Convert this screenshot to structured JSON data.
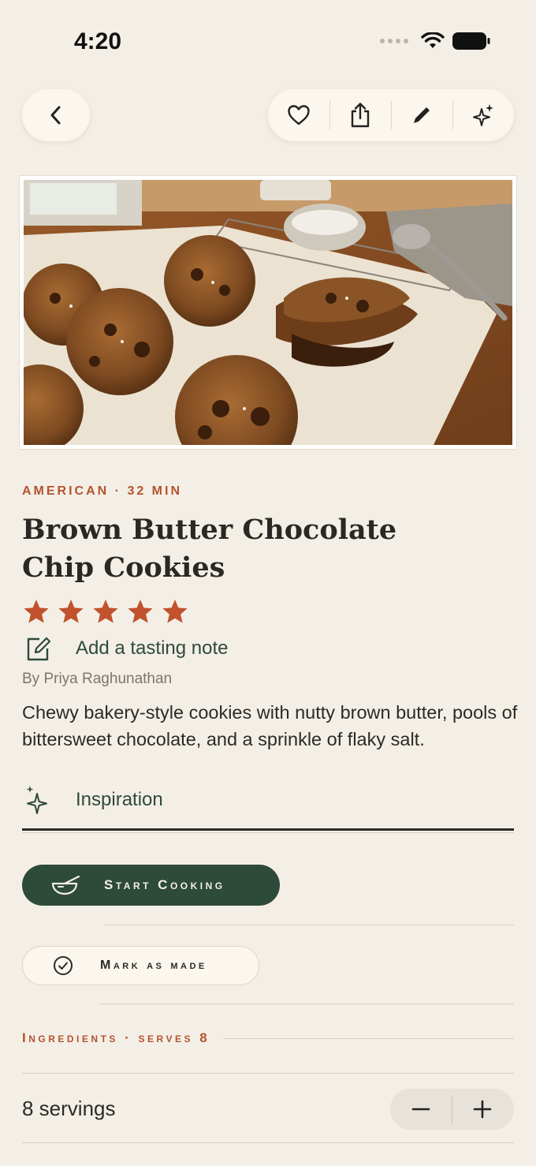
{
  "status_bar": {
    "time": "4:20"
  },
  "nav": {
    "back_icon": "chevron-left-icon",
    "actions": [
      {
        "name": "favorite-button",
        "icon": "heart-icon"
      },
      {
        "name": "share-button",
        "icon": "share-icon"
      },
      {
        "name": "edit-button",
        "icon": "pencil-icon"
      },
      {
        "name": "ai-button",
        "icon": "sparkles-icon"
      }
    ]
  },
  "recipe": {
    "meta": "AMERICAN · 32 MIN",
    "title": "Brown Butter Chocolate Chip Cookies",
    "rating": 5,
    "tasting_note_label": "Add a tasting note",
    "byline": "By Priya Raghunathan",
    "description": "Chewy bakery-style cookies with nutty brown butter, pools of bittersweet chocolate, and a sprinkle of flaky salt.",
    "inspiration_label": "Inspiration"
  },
  "actions": {
    "start_cooking": "Start Cooking",
    "mark_as_made": "Mark as made"
  },
  "ingredients": {
    "header": "Ingredients · serves 8",
    "servings_label": "8 servings",
    "decrement": "−",
    "increment": "+"
  },
  "colors": {
    "background": "#f4efe6",
    "accent": "#b4532f",
    "primary_green": "#2d4a3a",
    "star": "#c0522d"
  }
}
